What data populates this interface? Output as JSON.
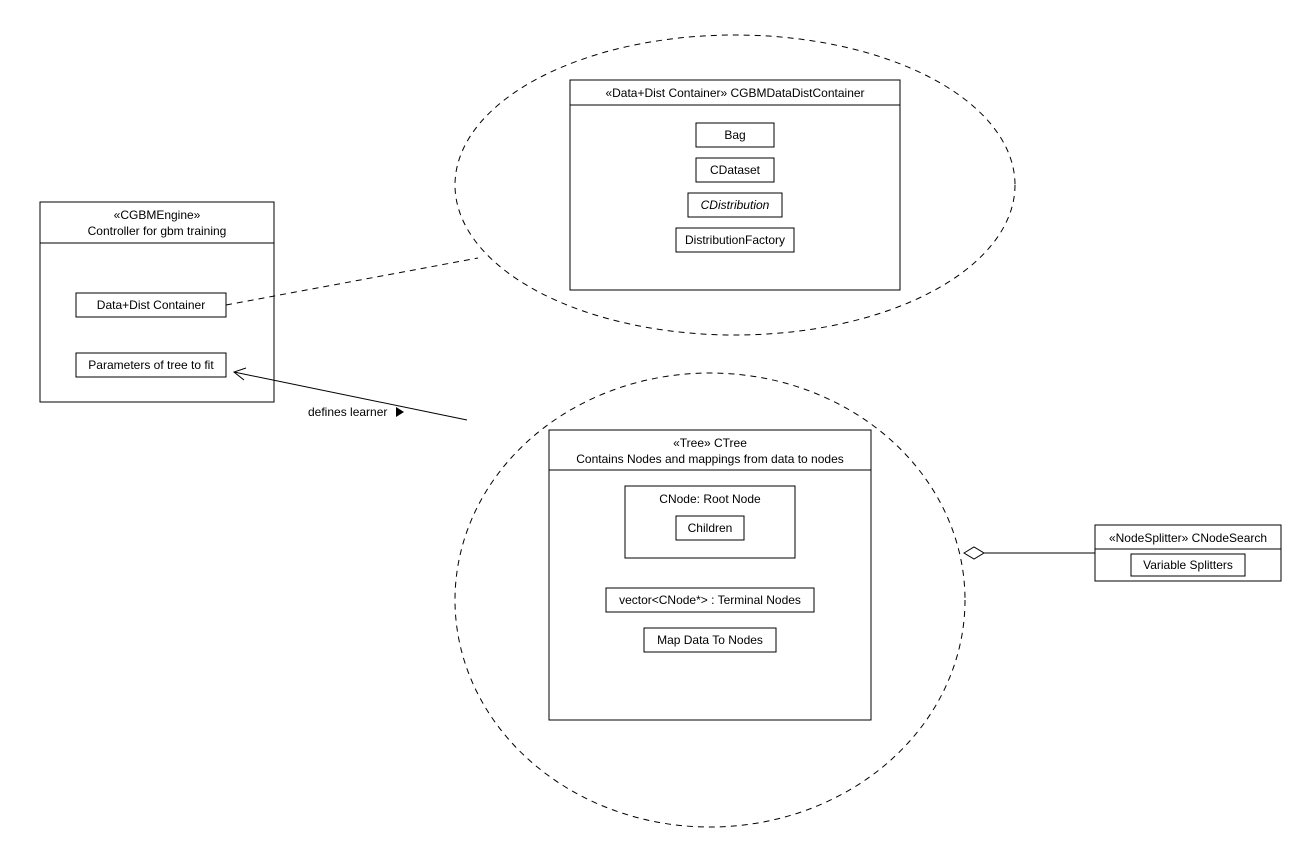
{
  "engine": {
    "stereotype": "«CGBMEngine»",
    "subtitle": "Controller for gbm training",
    "items": {
      "dataDist": "Data+Dist Container",
      "params": "Parameters of tree to fit"
    }
  },
  "dataDistContainer": {
    "title": "«Data+Dist Container» CGBMDataDistContainer",
    "items": {
      "bag": "Bag",
      "cdataset": "CDataset",
      "cdistribution": "CDistribution",
      "distFactory": "DistributionFactory"
    }
  },
  "tree": {
    "stereotype": "«Tree» CTree",
    "subtitle": "Contains Nodes and mappings from data to nodes",
    "rootNode": "CNode: Root Node",
    "children": "Children",
    "terminalNodes": "vector<CNode*> : Terminal Nodes",
    "mapData": "Map Data To Nodes"
  },
  "nodeSplitter": {
    "title": "«NodeSplitter» CNodeSearch",
    "item": "Variable Splitters"
  },
  "edge": {
    "definesLearner": "defines learner"
  }
}
